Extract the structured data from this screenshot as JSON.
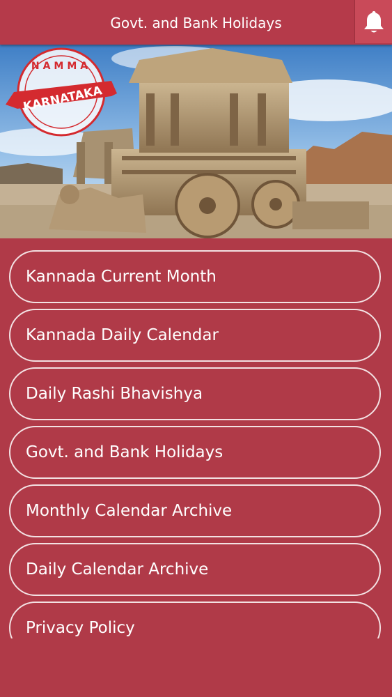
{
  "header": {
    "title": "Govt. and Bank Holidays",
    "notification_icon": "bell-icon"
  },
  "banner": {
    "badge_top_text": "NAMMA",
    "badge_main_text": "KARNATAKA",
    "image_subject": "stone chariot temple photo"
  },
  "menu": {
    "items": [
      {
        "label": "Kannada Current Month"
      },
      {
        "label": "Kannada Daily Calendar"
      },
      {
        "label": "Daily Rashi Bhavishya"
      },
      {
        "label": "Govt. and Bank Holidays"
      },
      {
        "label": "Monthly Calendar Archive"
      },
      {
        "label": "Daily Calendar Archive"
      },
      {
        "label": "Privacy Policy"
      }
    ]
  },
  "colors": {
    "app_background": "#b03a48",
    "header_background": "#b53a4a",
    "text": "#ffffff",
    "badge_ribbon": "#d42a2f"
  }
}
